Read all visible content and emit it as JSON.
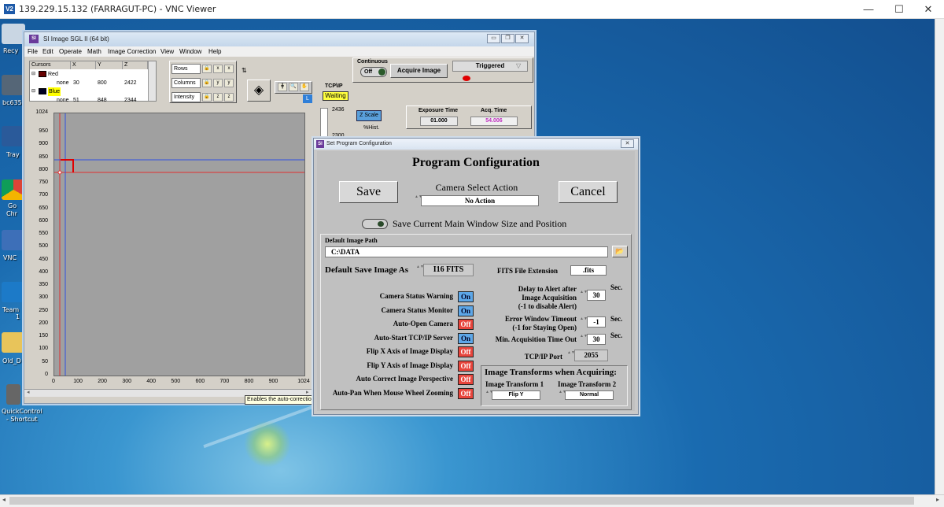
{
  "vnc": {
    "logo": "V2",
    "title": "139.229.15.132 (FARRAGUT-PC) - VNC Viewer",
    "min": "—",
    "max": "☐",
    "close": "✕"
  },
  "desktop": {
    "icons": [
      {
        "label": "Recy"
      },
      {
        "label": "bc635"
      },
      {
        "label": "Tray"
      },
      {
        "label": "Go"
      },
      {
        "label": "Chr"
      },
      {
        "label": "VNC"
      },
      {
        "label": "Team"
      },
      {
        "label": "1"
      },
      {
        "label": "Old_D"
      },
      {
        "label": "QuickControl"
      },
      {
        "label": "- Shortcut"
      }
    ]
  },
  "sgl": {
    "title": "SI Image SGL II  (64 bit)",
    "menu": [
      "File",
      "Edit",
      "Operate",
      "Math",
      "Image Correction",
      "View",
      "Window",
      "Help"
    ],
    "cursors": {
      "headers": [
        "Cursors",
        "X",
        "Y",
        "Z"
      ],
      "rows": [
        {
          "name": "Red",
          "x": "",
          "y": "",
          "z": ""
        },
        {
          "name": "none",
          "x": "30",
          "y": "800",
          "z": "2422"
        },
        {
          "name": "Blue",
          "x": "",
          "y": "",
          "z": ""
        },
        {
          "name": "none",
          "x": "51",
          "y": "848",
          "z": "2344"
        }
      ]
    },
    "axes_ctrl": [
      "Rows",
      "Columns",
      "Intensity"
    ],
    "continuous_label": "Continuous",
    "continuous_state": "Off",
    "acquire_label": "Acquire Image",
    "triggered_label": "Triggered",
    "tcpip_label": "TCP\\IP",
    "L": "L",
    "waiting_label": "Waiting",
    "zscale_label": "Z Scale",
    "hist_label": "%Hist.",
    "z_top": "2436",
    "z_second": "2300",
    "exposure_label": "Exposure Time",
    "exposure_value": "01.000",
    "acq_label": "Acq. Time",
    "acq_value": "54.006",
    "yticks": [
      "1024",
      "950",
      "900",
      "850",
      "800",
      "750",
      "700",
      "650",
      "600",
      "550",
      "500",
      "450",
      "400",
      "350",
      "300",
      "250",
      "200",
      "150",
      "100",
      "50",
      "0"
    ],
    "xticks": [
      "0",
      "100",
      "200",
      "300",
      "400",
      "500",
      "600",
      "700",
      "800",
      "900",
      "1024"
    ]
  },
  "dialog": {
    "title": "Set Program Configuration",
    "heading": "Program Configuration",
    "save": "Save",
    "cancel": "Cancel",
    "camera_select_label": "Camera Select Action",
    "camera_select_value": "No Action",
    "save_window_label": "Save Current Main Window Size and Position",
    "default_path_label": "Default Image Path",
    "default_path_value": "C:\\DATA",
    "default_save_label": "Default Save Image As",
    "default_save_value": "I16 FITS",
    "fits_ext_label": "FITS File Extension",
    "fits_ext_value": ".fits",
    "toggles": [
      {
        "label": "Camera Status Warning",
        "state": "On"
      },
      {
        "label": "Camera Status Monitor",
        "state": "On"
      },
      {
        "label": "Auto-Open Camera",
        "state": "Off"
      },
      {
        "label": "Auto-Start TCP/IP Server",
        "state": "On"
      },
      {
        "label": "Flip X Axis of Image Display",
        "state": "Off"
      },
      {
        "label": "Flip Y Axis of Image Display",
        "state": "Off"
      },
      {
        "label": "Auto Correct Image Perspective",
        "state": "Off"
      },
      {
        "label": "Auto-Pan When Mouse Wheel Zooming",
        "state": "Off"
      }
    ],
    "delay_label_1": "Delay to Alert after",
    "delay_label_2": "Image Acquisition",
    "delay_label_3": "(-1 to disable Alert)",
    "delay_value": "30",
    "sec": "Sec.",
    "error_label_1": "Error Window Timeout",
    "error_label_2": "(-1 for Staying Open)",
    "error_value": "-1",
    "min_acq_label": "Min. Acquisition Time Out",
    "min_acq_value": "30",
    "tcp_port_label": "TCP/IP Port",
    "tcp_port_value": "2055",
    "transforms_title": "Image Transforms when Acquiring:",
    "transform1_label": "Image Transform 1",
    "transform1_value": "Flip Y",
    "transform2_label": "Image Transform 2",
    "transform2_value": "Normal"
  },
  "tooltip": "Enables the auto-correction of the Image Perspective when the image is auto-scaled.",
  "colors": {
    "red_cursor": "#e03030",
    "blue_cursor": "#3050e0",
    "on": "#5da7e8",
    "off": "#e8453c"
  }
}
